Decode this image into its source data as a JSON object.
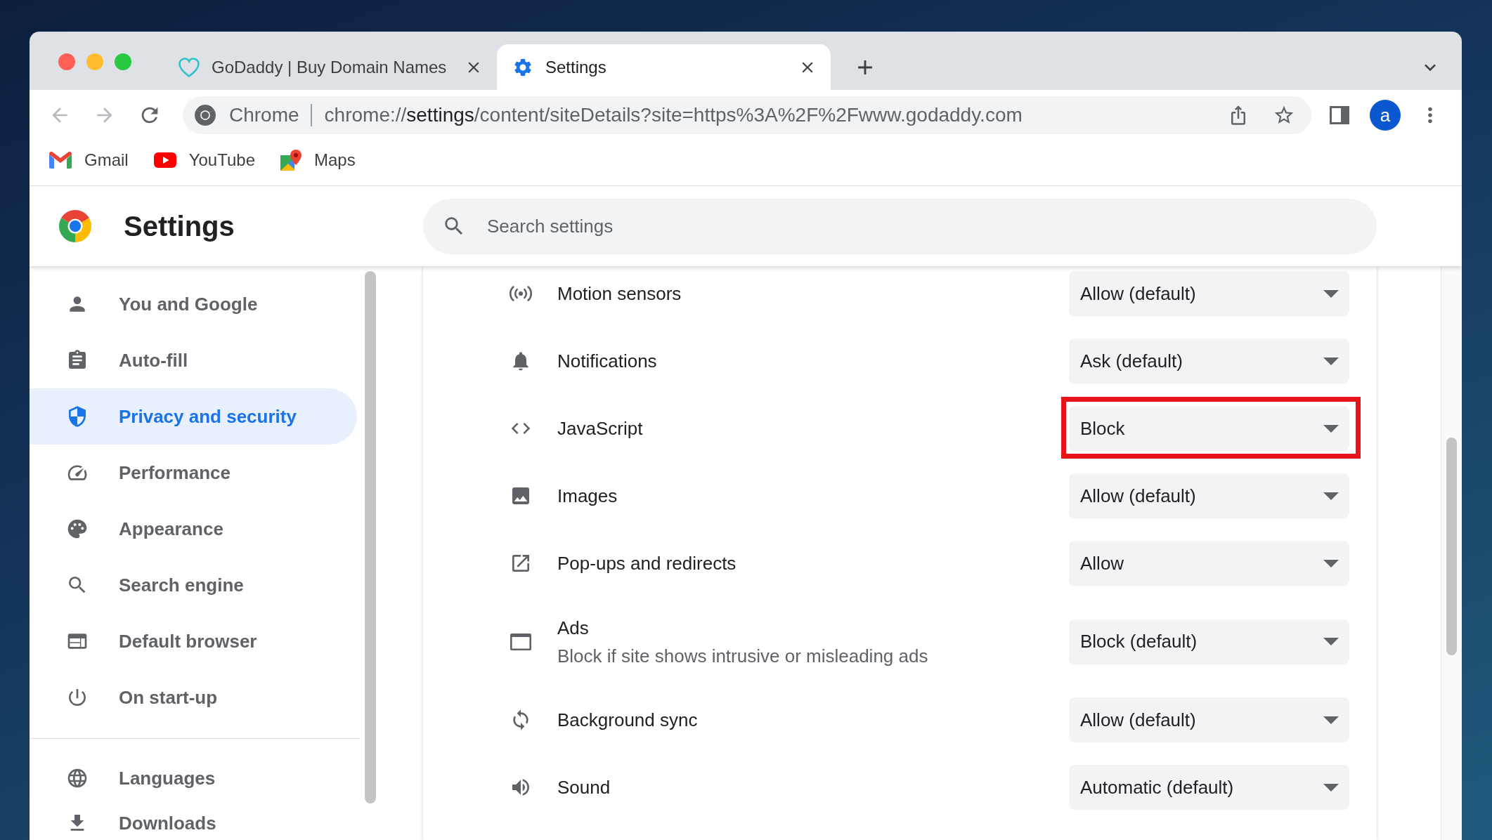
{
  "tabs": [
    {
      "title": "GoDaddy | Buy Domain Names",
      "selected": false
    },
    {
      "title": "Settings",
      "selected": true
    }
  ],
  "toolbar": {
    "back": {
      "disabled": true
    },
    "forward": {
      "disabled": true
    },
    "omnibox": {
      "site_label": "Chrome",
      "url": {
        "scheme": "chrome://",
        "host": "settings",
        "path": "/content/siteDetails?site=https%3A%2F%2Fwww.godaddy.com"
      }
    },
    "profile": {
      "initial": "a"
    }
  },
  "bookmarks": [
    {
      "label": "Gmail"
    },
    {
      "label": "YouTube"
    },
    {
      "label": "Maps"
    }
  ],
  "header": {
    "title": "Settings",
    "search": {
      "placeholder": "Search settings"
    }
  },
  "sidebar": {
    "sections": [
      {
        "items": [
          {
            "label": "You and Google",
            "selected": false
          },
          {
            "label": "Auto-fill",
            "selected": false
          },
          {
            "label": "Privacy and security",
            "selected": true
          },
          {
            "label": "Performance",
            "selected": false
          },
          {
            "label": "Appearance",
            "selected": false
          },
          {
            "label": "Search engine",
            "selected": false
          },
          {
            "label": "Default browser",
            "selected": false
          },
          {
            "label": "On start-up",
            "selected": false
          }
        ]
      },
      {
        "items": [
          {
            "label": "Languages",
            "selected": false
          },
          {
            "label": "Downloads",
            "selected": false
          }
        ]
      }
    ]
  },
  "content": {
    "rows": [
      {
        "label": "Motion sensors",
        "value": "Allow (default)",
        "highlighted": false
      },
      {
        "label": "Notifications",
        "value": "Ask (default)",
        "highlighted": false
      },
      {
        "label": "JavaScript",
        "value": "Block",
        "highlighted": true
      },
      {
        "label": "Images",
        "value": "Allow (default)",
        "highlighted": false
      },
      {
        "label": "Pop-ups and redirects",
        "value": "Allow",
        "highlighted": false
      },
      {
        "label": "Ads",
        "description": "Block if site shows intrusive or misleading ads",
        "value": "Block (default)",
        "highlighted": false
      },
      {
        "label": "Background sync",
        "value": "Allow (default)",
        "highlighted": false
      },
      {
        "label": "Sound",
        "value": "Automatic (default)",
        "highlighted": false
      }
    ]
  }
}
